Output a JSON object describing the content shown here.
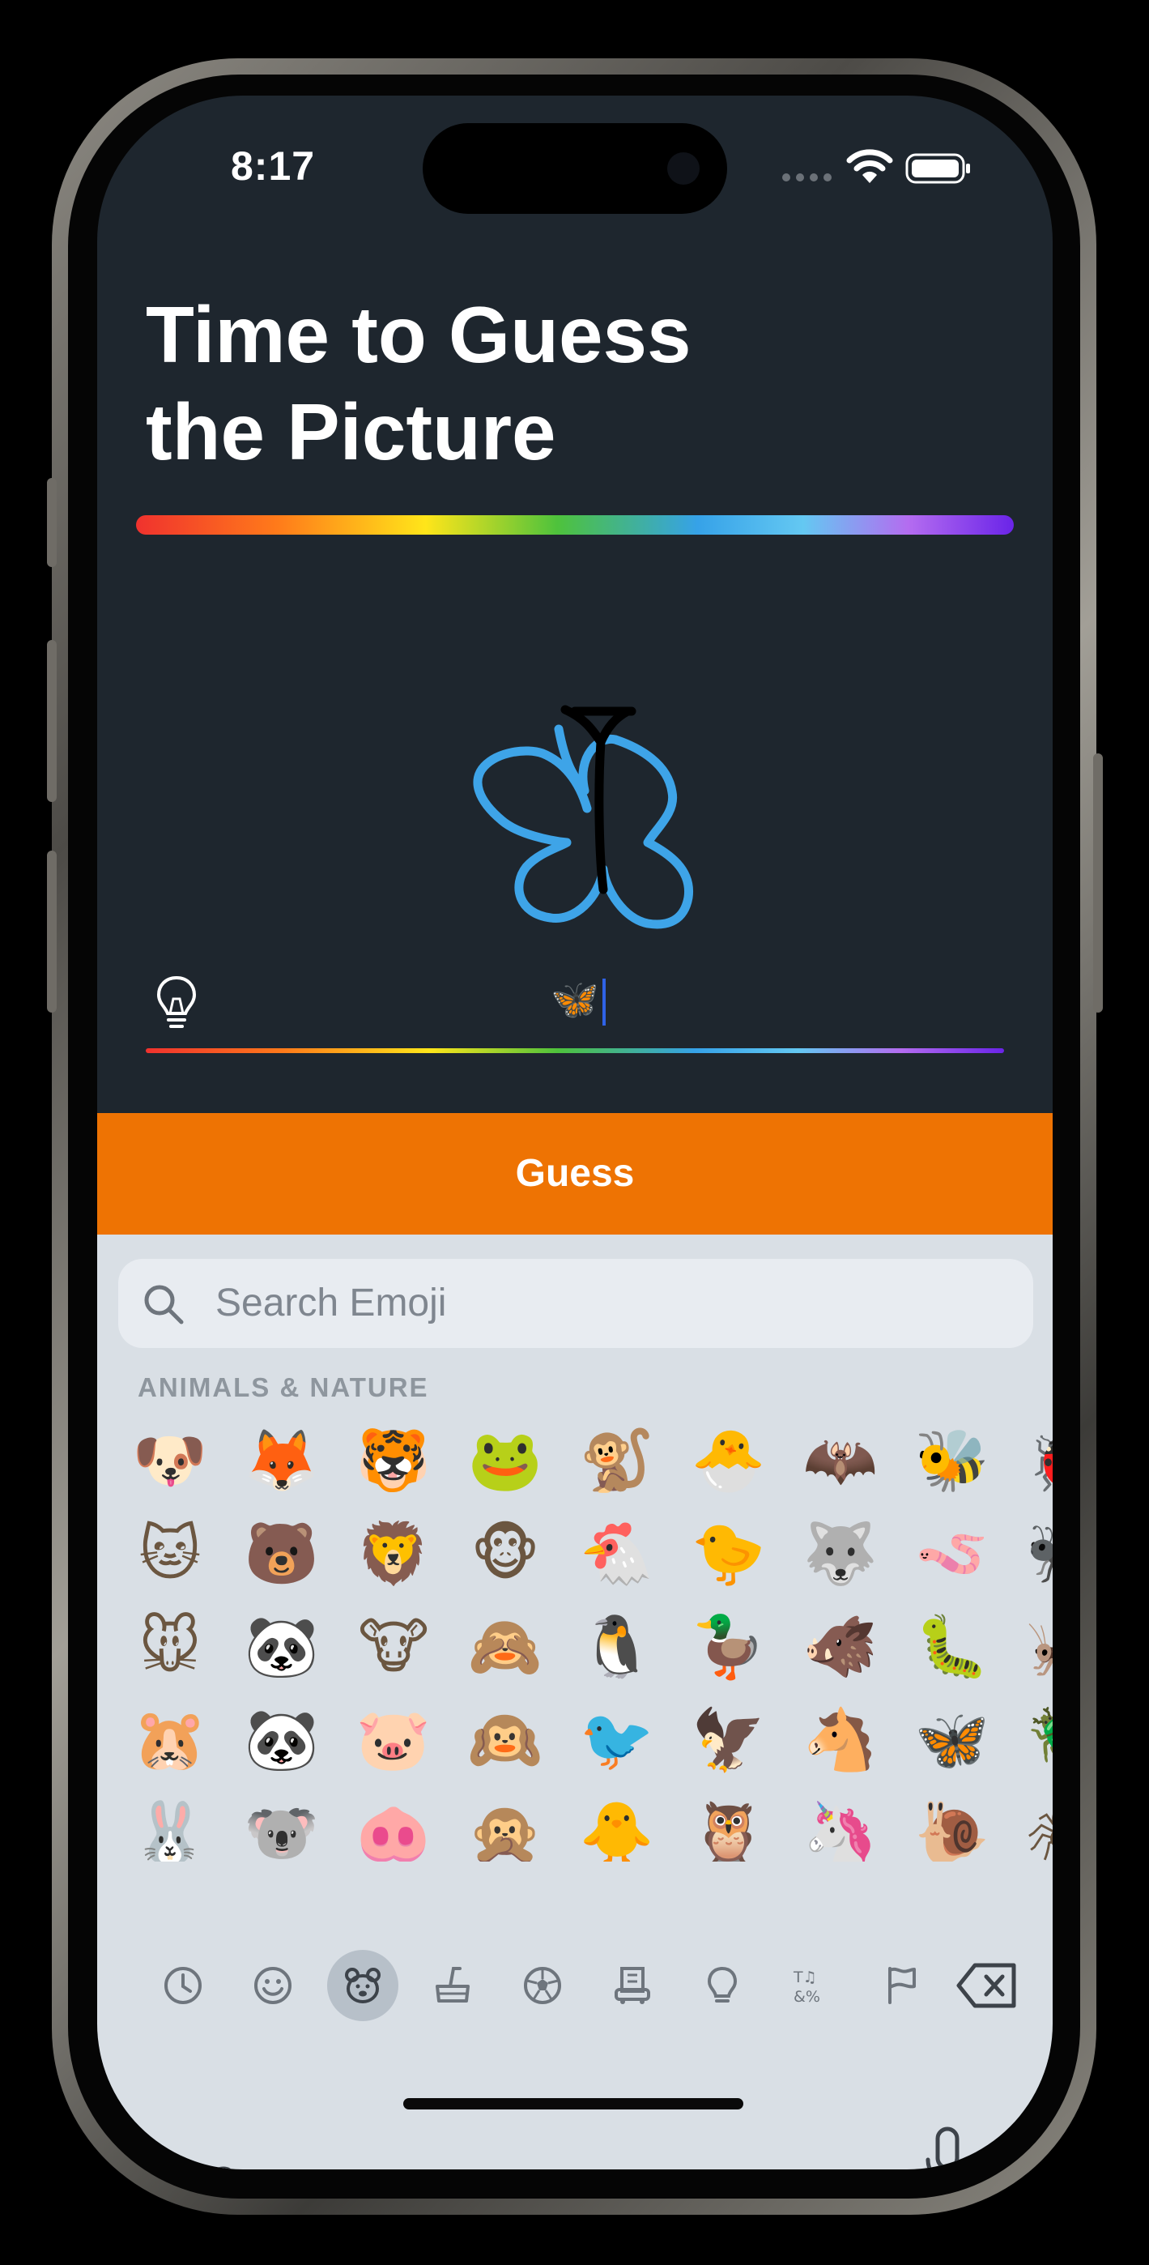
{
  "status_bar": {
    "time": "8:17"
  },
  "header": {
    "title_line1": "Time to Guess",
    "title_line2": "the Picture"
  },
  "guess": {
    "input_value": "🦋"
  },
  "guess_button": {
    "label": "Guess"
  },
  "keyboard": {
    "search_placeholder": "Search Emoji",
    "category_label": "ANIMALS & NATURE",
    "emoji_rows": [
      [
        "🐶",
        "🦊",
        "🐯",
        "🐸",
        "🐒",
        "🐣",
        "🦇",
        "🐝",
        "🐞"
      ],
      [
        "🐱",
        "🐻",
        "🦁",
        "🐵",
        "🐔",
        "🐤",
        "🐺",
        "🪱",
        "🐜"
      ],
      [
        "🐭",
        "🐼",
        "🐮",
        "🙈",
        "🐧",
        "🦆",
        "🐗",
        "🐛",
        "🦗"
      ],
      [
        "🐹",
        "🐼",
        "🐷",
        "🙉",
        "🐦",
        "🦅",
        "🐴",
        "🦋",
        "🪲"
      ],
      [
        "🐰",
        "🐨",
        "🐽",
        "🙊",
        "🐥",
        "🦉",
        "🦄",
        "🐌",
        "🕷"
      ]
    ],
    "categories": [
      "recent-icon",
      "smiley-icon",
      "animal-icon",
      "food-icon",
      "activity-icon",
      "travel-icon",
      "objects-icon",
      "symbols-icon",
      "flags-icon"
    ],
    "selected_category": "animal-icon",
    "abc_label": "ABC"
  },
  "colors": {
    "background": "#1e262e",
    "guess_button": "#ee7303",
    "keyboard": "#d9dfe5",
    "drawing_butterfly": "#3ea4e8",
    "drawing_body": "#000000"
  }
}
